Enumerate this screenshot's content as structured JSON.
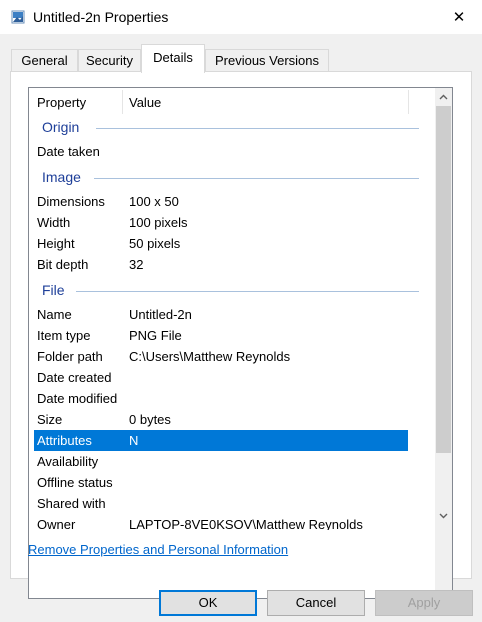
{
  "window": {
    "title": "Untitled-2n Properties",
    "close_glyph": "✕"
  },
  "tabs": [
    {
      "label": "General"
    },
    {
      "label": "Security"
    },
    {
      "label": "Details",
      "active": true
    },
    {
      "label": "Previous Versions"
    }
  ],
  "details": {
    "columns": {
      "property": "Property",
      "value": "Value"
    },
    "groups": {
      "origin": "Origin",
      "image": "Image",
      "file": "File"
    },
    "rows": {
      "date_taken": {
        "property": "Date taken",
        "value": ""
      },
      "dimensions": {
        "property": "Dimensions",
        "value": "100 x 50"
      },
      "width": {
        "property": "Width",
        "value": "100 pixels"
      },
      "height": {
        "property": "Height",
        "value": "50 pixels"
      },
      "bit_depth": {
        "property": "Bit depth",
        "value": "32"
      },
      "name": {
        "property": "Name",
        "value": "Untitled-2n"
      },
      "item_type": {
        "property": "Item type",
        "value": "PNG File"
      },
      "folder_path": {
        "property": "Folder path",
        "value": "C:\\Users\\Matthew Reynolds"
      },
      "date_created": {
        "property": "Date created",
        "value": ""
      },
      "date_modified": {
        "property": "Date modified",
        "value": ""
      },
      "size": {
        "property": "Size",
        "value": "0 bytes"
      },
      "attributes": {
        "property": "Attributes",
        "value": "N"
      },
      "availability": {
        "property": "Availability",
        "value": ""
      },
      "offline_status": {
        "property": "Offline status",
        "value": ""
      },
      "shared_with": {
        "property": "Shared with",
        "value": ""
      },
      "owner": {
        "property": "Owner",
        "value": "LAPTOP-8VE0KSOV\\Matthew Reynolds"
      }
    }
  },
  "link": {
    "label": "Remove Properties and Personal Information"
  },
  "buttons": {
    "ok": "OK",
    "cancel": "Cancel",
    "apply": "Apply"
  },
  "colors": {
    "selection": "#0078d7",
    "group_heading": "#1e3f99",
    "link": "#0066cc"
  }
}
